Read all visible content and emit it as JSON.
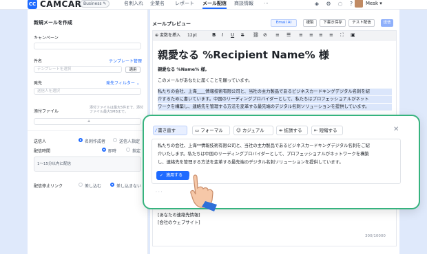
{
  "topbar": {
    "logo": "CC",
    "brand": "CAMCARD",
    "badge": "Business ✎",
    "nav": [
      "名刺入れ",
      "企業名",
      "レポート",
      "メール配信",
      "商談情報",
      "···"
    ],
    "user": "Mesk ▾"
  },
  "left": {
    "title": "新規メールを作成",
    "campaign_label": "キャンペーン",
    "subject_label": "件名",
    "template_link": "テンプレート管理",
    "template_placeholder": "テンプレートを選択",
    "apply_button": "適用",
    "sender_label": "発先",
    "filter_link": "発先フィルター ⌄",
    "sender_placeholder": "送信人を選択",
    "attach_label": "添付ファイル",
    "attach_hint": "添付ファイルは最大5件まで、添付ファイル最大5MBまで。",
    "attach_plus": "+",
    "from_label": "送信人",
    "from_opt1": "名刺作成者",
    "from_opt2": "送信人指定",
    "time_label": "配信時間",
    "time_opt1": "即時",
    "time_opt2": "指定",
    "interval_hint": "1〜15分以内に配信",
    "optout_label": "配信停止リンク",
    "optout_opt1": "差し込む",
    "optout_opt2": "差し込まない"
  },
  "right": {
    "title": "メールプレビュー",
    "ai_button": "Email AI",
    "btn_copy": "複製",
    "btn_draft": "下書き保存",
    "btn_test": "テスト配信",
    "btn_send": "送信",
    "insert_var": "変数を挿入",
    "font_size": "12pt",
    "subject": "親愛なる %Recipient Name% 様",
    "greeting": "親愛なる %Name% 様,",
    "line1": "このメールがあなたに届くことを願っています。",
    "line2": "私たちの会社、上海____情報技術有限公司と、当社の主力製品であるビジネスカードキングデジタル名刺を紹",
    "line3": "介するために書いています。中国のリーディングプロバイダーとして、私たちはプロフェッショナルがネット",
    "line4": "ワークを構築し、連絡先を管理する方法を変革する最先端のデジタル名刺ソリューションを提供しています。",
    "footer1": "[あなたの連絡先情報]",
    "footer2": "[会社のウェブサイト]",
    "counter": "300/10000"
  },
  "ai_panel": {
    "chips": [
      "書き直す",
      "フォーマル",
      "カジュアル",
      "拡張する",
      "短縮する"
    ],
    "result1": "私たちの会社、上海**情報技術有限公司と、当社の主力製品であるビジネスカードキングデジタル名刺をご紹",
    "result2": "介いたします。私たちは中国のリーディングプロバイダーとして、プロフェッショナルがネットワークを構築",
    "result3": "し、連絡先を管理する方法を変革する最先端のデジタル名刺ソリューションを提供しています。",
    "apply_button": "適用する",
    "close": "✕",
    "more": "· · ·"
  }
}
